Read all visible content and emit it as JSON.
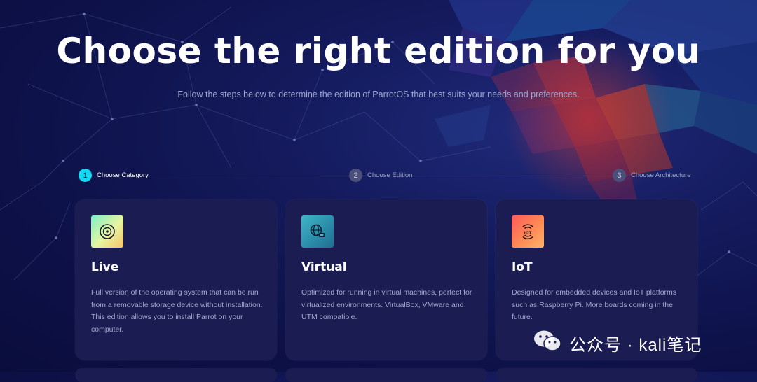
{
  "hero": {
    "title": "Choose the right edition for you",
    "subtitle": "Follow the steps below to determine the edition of ParrotOS that best suits your needs and preferences."
  },
  "steps": [
    {
      "number": "1",
      "label": "Choose Category",
      "state": "active"
    },
    {
      "number": "2",
      "label": "Choose Edition",
      "state": "inactive"
    },
    {
      "number": "3",
      "label": "Choose Architecture",
      "state": "inactive"
    }
  ],
  "cards": [
    {
      "title": "Live",
      "icon": "disc-icon",
      "description": "Full version of the operating system that can be run from a removable storage device without installation. This edition allows you to install Parrot on your computer."
    },
    {
      "title": "Virtual",
      "icon": "virtual-network-icon",
      "description": "Optimized for running in virtual machines, perfect for virtualized environments. VirtualBox, VMware and UTM compatible."
    },
    {
      "title": "IoT",
      "icon": "iot-icon",
      "description": "Designed for embedded devices and IoT platforms such as Raspberry Pi. More boards coming in the future."
    }
  ],
  "watermark": {
    "text": "公众号 · kali笔记",
    "icon": "wechat-icon"
  },
  "colors": {
    "accent": "#13d9f2",
    "card": "#1b1c52",
    "background": "#0d1148"
  }
}
